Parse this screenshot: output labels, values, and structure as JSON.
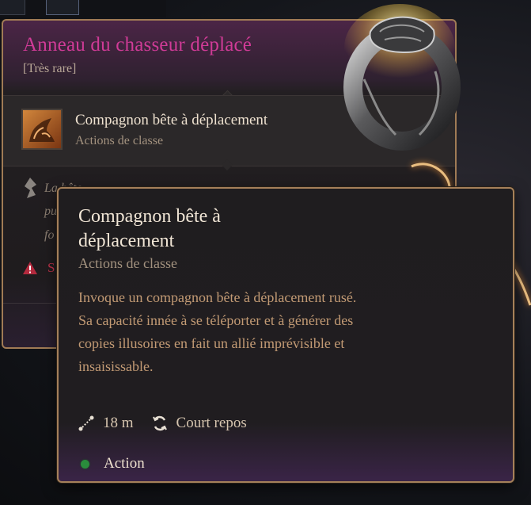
{
  "item": {
    "name": "Anneau du chasseur déplacé",
    "rarity": "[Très rare]",
    "linked_skill": {
      "name": "Compagnon bête à déplacement",
      "category": "Actions de classe",
      "icon": "displacer-beast-icon"
    },
    "faded_description_lines": [
      "La bête",
      "pu",
      "fo"
    ],
    "warning_text": "S",
    "icons": {
      "description": "shard-icon",
      "warning": "warning-icon",
      "ring": "ring-image"
    }
  },
  "skill_tooltip": {
    "title": "Compagnon bête à déplacement",
    "category": "Actions de classe",
    "description": "Invoque un compagnon bête à déplacement rusé. Sa capacité innée à se téléporter et à générer des copies illusoires en fait un allié imprévisible et insaisissable.",
    "range": "18 m",
    "recharge": "Court repos",
    "cost": "Action",
    "icons": {
      "range": "range-icon",
      "recharge": "short-rest-icon",
      "cost": "action-dot-icon"
    }
  },
  "colors": {
    "item_name": "#d03b97",
    "rarity": "#b9a897",
    "description": "#c29a74",
    "warning": "#c2334a",
    "action_dot": "#2a8c3c",
    "border_gold": "#a5805a"
  }
}
